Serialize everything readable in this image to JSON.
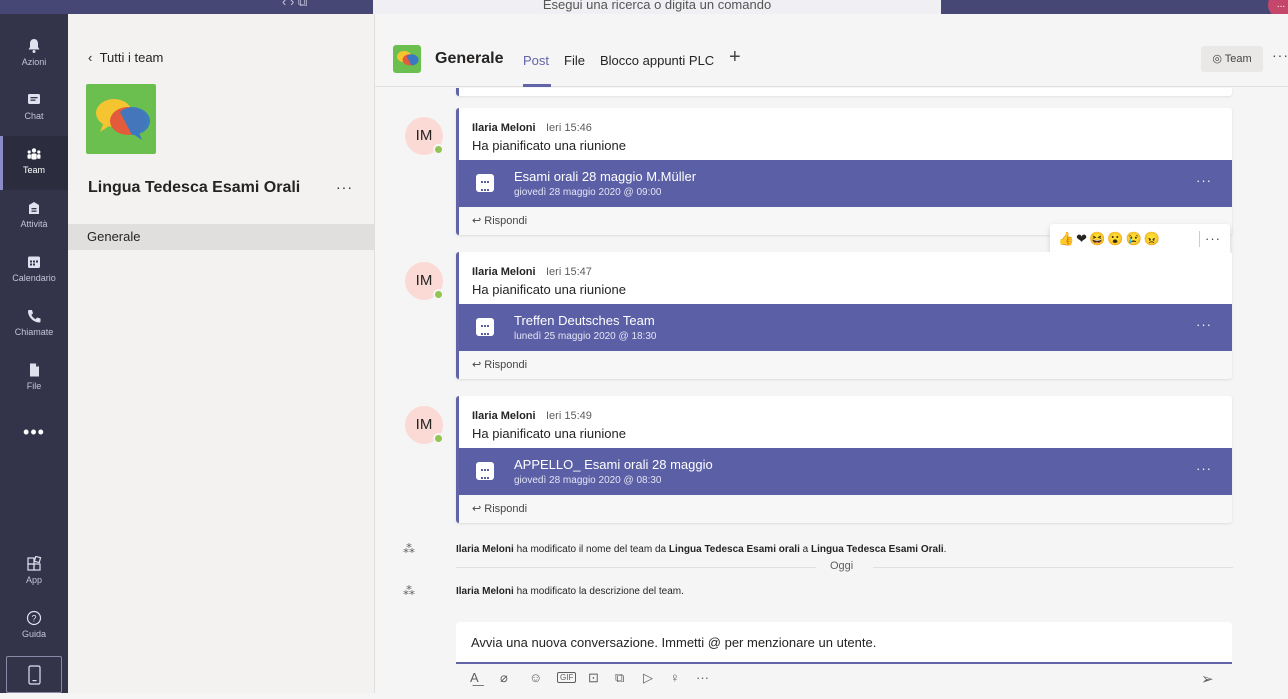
{
  "topbar": {
    "nav_arrows": "‹  ›   ⧉",
    "search_placeholder": "Esegui una ricerca o digita un comando",
    "user_initials": "..."
  },
  "rail": {
    "items": [
      {
        "label": "Azioni",
        "icon": "bell-icon"
      },
      {
        "label": "Chat",
        "icon": "chat-icon"
      },
      {
        "label": "Team",
        "icon": "team-icon"
      },
      {
        "label": "Attività",
        "icon": "assignment-icon"
      },
      {
        "label": "Calendario",
        "icon": "calendar-icon"
      },
      {
        "label": "Chiamate",
        "icon": "phone-icon"
      },
      {
        "label": "File",
        "icon": "file-icon"
      }
    ],
    "more": "•••",
    "bottom": [
      {
        "label": "App",
        "icon": "apps-icon"
      },
      {
        "label": "Guida",
        "icon": "help-icon"
      }
    ]
  },
  "team_panel": {
    "back": "Tutti i team",
    "team_name": "Lingua Tedesca Esami Orali",
    "more": "···",
    "channels": [
      "Generale"
    ]
  },
  "header": {
    "channel": "Generale",
    "tabs": [
      "Post",
      "File",
      "Blocco appunti PLC"
    ],
    "add": "+",
    "team_button": "Team",
    "more": "···"
  },
  "posts": [
    {
      "initials": "IM",
      "author": "Ilaria Meloni",
      "time": "Ieri 15:46",
      "text": "Ha pianificato una riunione",
      "meeting_title": "Esami orali 28 maggio M.Müller",
      "meeting_date": "giovedì 28 maggio 2020 @ 09:00",
      "reply": "Rispondi"
    },
    {
      "initials": "IM",
      "author": "Ilaria Meloni",
      "time": "Ieri 15:47",
      "text": "Ha pianificato una riunione",
      "meeting_title": "Treffen Deutsches Team",
      "meeting_date": "lunedì 25 maggio 2020 @ 18:30",
      "reply": "Rispondi"
    },
    {
      "initials": "IM",
      "author": "Ilaria Meloni",
      "time": "Ieri 15:49",
      "text": "Ha pianificato una riunione",
      "meeting_title": "APPELLO_ Esami orali 28 maggio",
      "meeting_date": "giovedì 28 maggio 2020 @ 08:30",
      "reply": "Rispondi"
    }
  ],
  "reactions": {
    "emojis": "👍❤😆😮😢😠",
    "more": "···"
  },
  "system": [
    {
      "actor": "Ilaria Meloni",
      "t1": " ha modificato il nome del team da ",
      "from": "Lingua Tedesca Esami orali",
      "t2": " a ",
      "to": "Lingua Tedesca Esami Orali",
      "end": "."
    },
    {
      "actor": "Ilaria Meloni",
      "t1": " ha modificato la descrizione del team."
    }
  ],
  "divider": "Oggi",
  "compose": {
    "placeholder": "Avvia una nuova conversazione. Immetti @ per menzionare un utente."
  },
  "toolbar": {
    "icons": [
      "format-icon",
      "attach-icon",
      "emoji-icon",
      "gif-icon",
      "sticker-icon",
      "meet-icon",
      "stream-icon",
      "praise-icon",
      "more-icon"
    ],
    "gif": "GIF",
    "more": "···"
  }
}
